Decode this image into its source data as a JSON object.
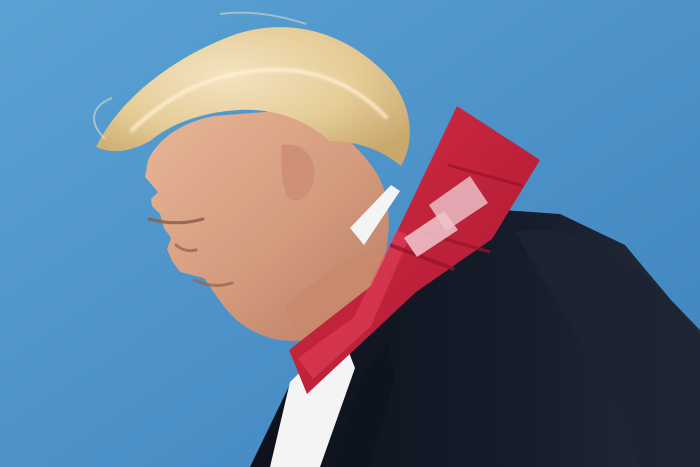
{
  "photo": {
    "subject": "person-in-profile",
    "colors": {
      "sky": "#4f95c9",
      "sky_dark": "#3f84bd",
      "hair": "#e9d3a4",
      "skin": "#d9a486",
      "suit": "#121724",
      "shirt": "#f1f1f1",
      "tie": "#c51f38",
      "tape": "#e7b7bf"
    }
  }
}
